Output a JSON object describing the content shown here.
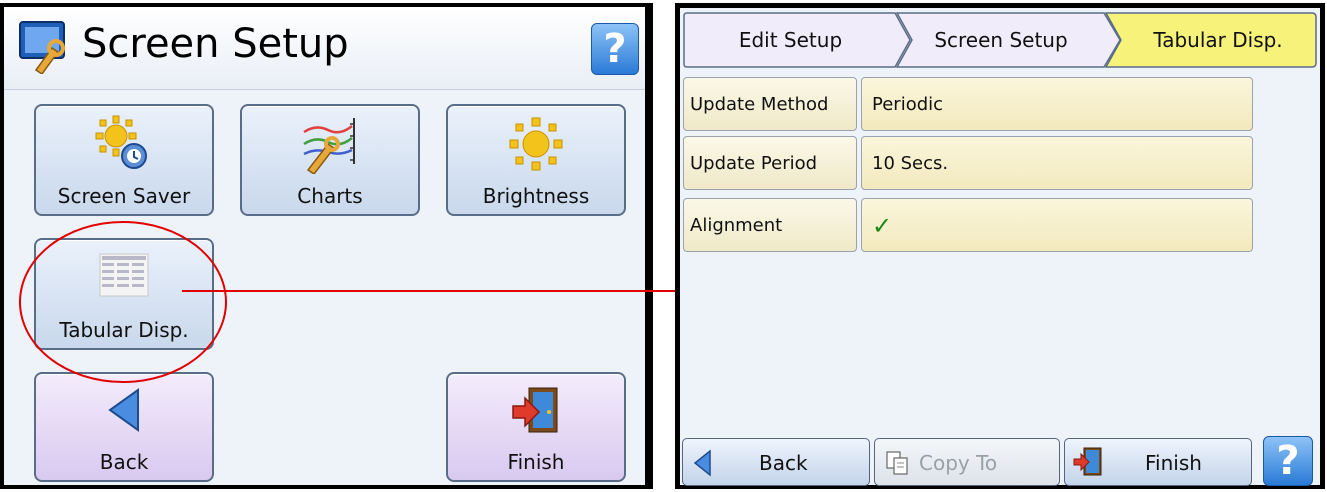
{
  "left_panel": {
    "title": "Screen Setup",
    "help_label": "?",
    "tiles": [
      {
        "label": "Screen Saver",
        "icon": "screen-saver-icon"
      },
      {
        "label": "Charts",
        "icon": "charts-icon"
      },
      {
        "label": "Brightness",
        "icon": "brightness-icon"
      },
      {
        "label": "Tabular Disp.",
        "icon": "tabular-display-icon"
      }
    ],
    "back_label": "Back",
    "finish_label": "Finish"
  },
  "right_panel": {
    "breadcrumbs": [
      "Edit Setup",
      "Screen Setup",
      "Tabular Disp."
    ],
    "rows": [
      {
        "key": "Update Method",
        "value": "Periodic"
      },
      {
        "key": "Update Period",
        "value": "10 Secs."
      },
      {
        "key": "Alignment",
        "value": "✓"
      }
    ],
    "buttons": {
      "back": "Back",
      "copy_to": "Copy To",
      "finish": "Finish",
      "help": "?"
    }
  },
  "colors": {
    "annotation": "#e00000",
    "active_crumb": "#f6f27a",
    "check": "#1a8a1a"
  }
}
